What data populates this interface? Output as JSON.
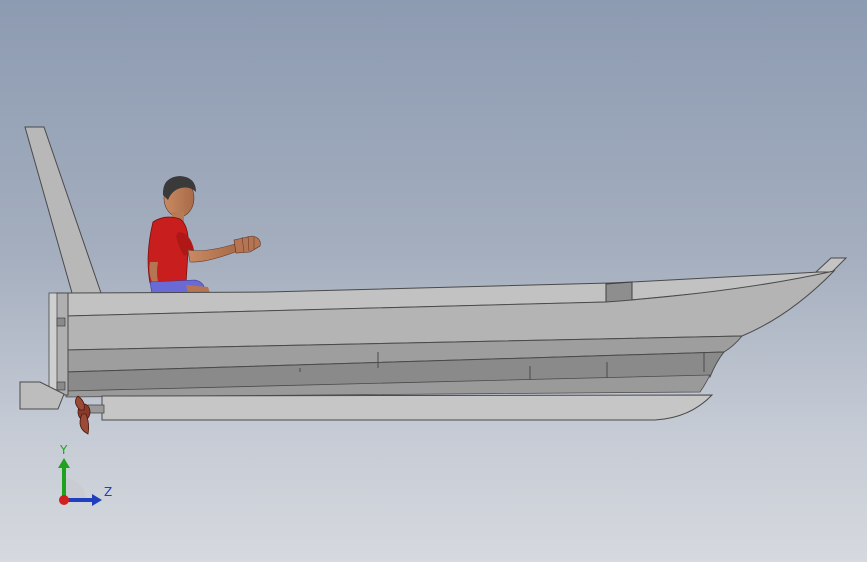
{
  "viewport": {
    "background_top": "#8d9bb2",
    "background_bottom": "#d6d9de"
  },
  "model": {
    "hull_color": "#a6a6a6",
    "shirt_color": "#c81e1e",
    "pants_color": "#6a6ad6",
    "propeller_color": "#8a3a2a"
  },
  "triad": {
    "y_label": "Y",
    "z_label": "Z",
    "y_color": "#1fa31f",
    "z_color": "#1f3fbf",
    "x_color": "#d01f1f"
  }
}
